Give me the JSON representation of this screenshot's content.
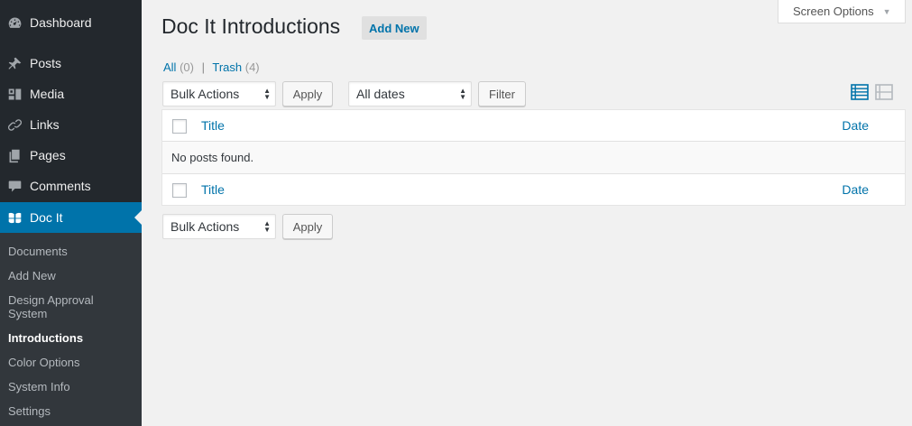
{
  "sidebar": {
    "items": [
      {
        "label": "Dashboard",
        "icon": "dashboard-icon"
      },
      {
        "label": "Posts",
        "icon": "pin-icon"
      },
      {
        "label": "Media",
        "icon": "media-icon"
      },
      {
        "label": "Links",
        "icon": "link-icon"
      },
      {
        "label": "Pages",
        "icon": "pages-icon"
      },
      {
        "label": "Comments",
        "icon": "comment-icon"
      },
      {
        "label": "Doc It",
        "icon": "docit-icon",
        "current": true
      }
    ],
    "submenu": [
      {
        "label": "Documents"
      },
      {
        "label": "Add New"
      },
      {
        "label": "Design Approval System"
      },
      {
        "label": "Introductions",
        "current": true
      },
      {
        "label": "Color Options"
      },
      {
        "label": "System Info"
      },
      {
        "label": "Settings"
      }
    ]
  },
  "header": {
    "title": "Doc It Introductions",
    "add_new_label": "Add New",
    "screen_options_label": "Screen Options"
  },
  "views": {
    "all_label": "All",
    "all_count": "(0)",
    "separator": "|",
    "trash_label": "Trash",
    "trash_count": "(4)"
  },
  "tablenav_top": {
    "bulk_actions": "Bulk Actions",
    "apply_label": "Apply",
    "dates": "All dates",
    "filter_label": "Filter"
  },
  "table": {
    "columns": {
      "title": "Title",
      "date": "Date"
    },
    "empty_message": "No posts found."
  },
  "tablenav_bottom": {
    "bulk_actions": "Bulk Actions",
    "apply_label": "Apply"
  },
  "colors": {
    "accent": "#0073aa",
    "sidebar_bg": "#23282d",
    "submenu_bg": "#32373c"
  }
}
